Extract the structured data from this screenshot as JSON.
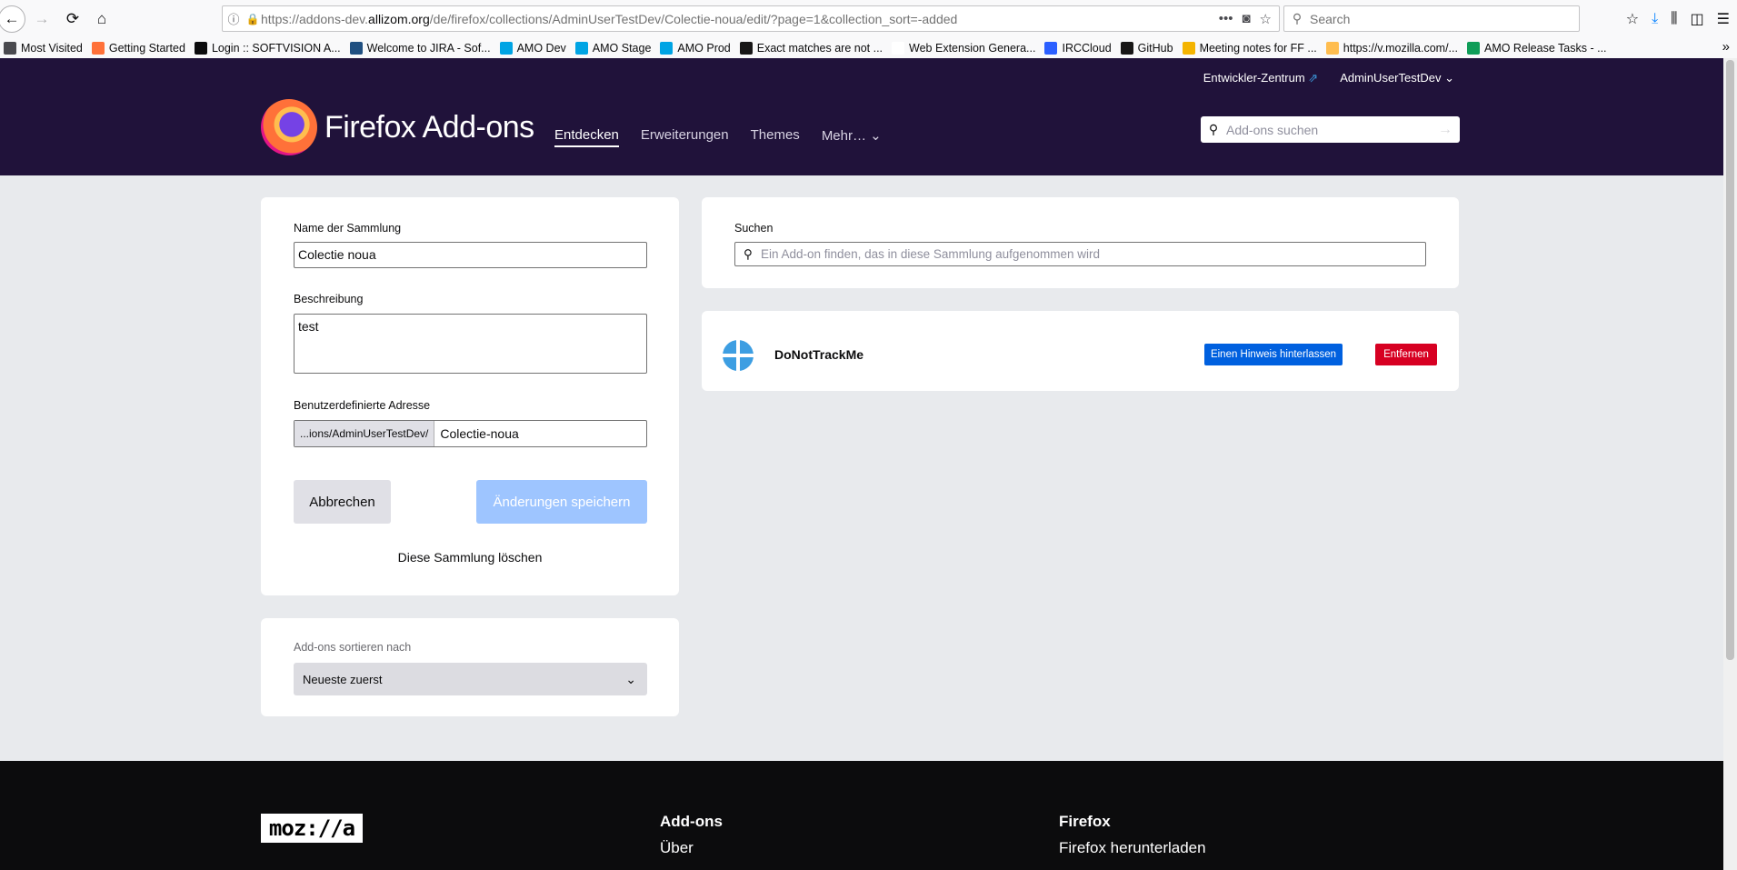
{
  "browser": {
    "url_prefix": "https://addons-dev.",
    "url_domain": "allizom.org",
    "url_rest": "/de/firefox/collections/AdminUserTestDev/Colectie-noua/edit/?page=1&collection_sort=-added",
    "search_placeholder": "Search",
    "bookmarks": [
      {
        "label": "Most Visited",
        "color": "#4a4a4f"
      },
      {
        "label": "Getting Started",
        "color": "#ff7139"
      },
      {
        "label": "Login :: SOFTVISION A...",
        "color": "#0c0c0d"
      },
      {
        "label": "Welcome to JIRA - Sof...",
        "color": "#205081"
      },
      {
        "label": "AMO Dev",
        "color": "#00a4e4"
      },
      {
        "label": "AMO Stage",
        "color": "#00a4e4"
      },
      {
        "label": "AMO Prod",
        "color": "#00a4e4"
      },
      {
        "label": "Exact matches are not ...",
        "color": "#181717"
      },
      {
        "label": "Web Extension Genera...",
        "color": "#ffffff"
      },
      {
        "label": "IRCCloud",
        "color": "#2b5fff"
      },
      {
        "label": "GitHub",
        "color": "#181717"
      },
      {
        "label": "Meeting notes for FF ...",
        "color": "#f4b400"
      },
      {
        "label": "https://v.mozilla.com/...",
        "color": "#ffbd4f"
      },
      {
        "label": "AMO Release Tasks - ...",
        "color": "#0f9d58"
      }
    ]
  },
  "header": {
    "dev_hub": "Entwickler-Zentrum",
    "user": "AdminUserTestDev",
    "logo_firefox": "Firefox",
    "logo_addons": "Add-ons",
    "nav": [
      "Entdecken",
      "Erweiterungen",
      "Themes",
      "Mehr…"
    ],
    "search_placeholder": "Add-ons suchen"
  },
  "form": {
    "name_label": "Name der Sammlung",
    "name_value": "Colectie noua",
    "desc_label": "Beschreibung",
    "desc_value": "test",
    "url_label": "Benutzerdefinierte Adresse",
    "url_prefix": "...ions/AdminUserTestDev/",
    "url_slug": "Colectie-noua",
    "cancel": "Abbrechen",
    "save": "Änderungen speichern",
    "delete": "Diese Sammlung löschen"
  },
  "sort": {
    "label": "Add-ons sortieren nach",
    "value": "Neueste zuerst"
  },
  "search_panel": {
    "label": "Suchen",
    "placeholder": "Ein Add-on finden, das in diese Sammlung aufgenommen wird"
  },
  "addon": {
    "name": "DoNotTrackMe",
    "note_button": "Einen Hinweis hinterlassen",
    "remove_button": "Entfernen"
  },
  "footer": {
    "logo": "moz://a",
    "col1_head": "Add-ons",
    "col1_link": "Über",
    "col2_head": "Firefox",
    "col2_link": "Firefox herunterladen"
  }
}
